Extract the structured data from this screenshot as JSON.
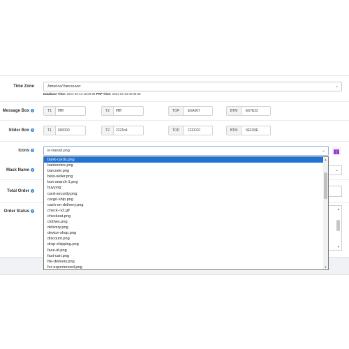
{
  "labels": {
    "time_zone": "Time Zone",
    "message_box": "Message Box",
    "slider_box": "Slider Box",
    "icons": "Icons",
    "mask_name": "Mask Name",
    "total_order": "Total Order",
    "order_status": "Order Status"
  },
  "time_zone": {
    "value": "America/Vancouver",
    "db_time_label": "Database Time:",
    "db_time_value": "2021-03-13 10:09:35",
    "php_time_label": "PHP Time:",
    "php_time_value": "2021-03-13 02:09:35"
  },
  "message_box": {
    "t1_label": "T1",
    "t1_value": "ffffff",
    "t2_label": "T2",
    "t2_value": "ffffff",
    "top_label": "TOP",
    "top_value": "E5A667",
    "btm_label": "BTM",
    "btm_value": "E67E22"
  },
  "slider_box": {
    "t1_label": "T1",
    "t1_value": "000000",
    "t2_label": "T2",
    "t2_value": "2221b4",
    "top_label": "TOP",
    "top_value": "FFFFFF",
    "btm_label": "BTM",
    "btm_value": "9EF09E"
  },
  "icons": {
    "selected": "in-transit.png",
    "options": [
      "bank-cards.png",
      "banknotes.png",
      "barcode.png",
      "best-seller.png",
      "box-search-1.png",
      "buy.png",
      "card-security.png",
      "cargo-ship.png",
      "cash-on-delivery.png",
      "check--v2.gif",
      "checkout.png",
      "clothes.png",
      "delivery.png",
      "device-shop.png",
      "discount.png",
      "drop-shipping.png",
      "face-id.png",
      "fast-cart.png",
      "file-delivery.png",
      "for-experienced.png"
    ],
    "highlighted_index": 0
  },
  "colors": {
    "accent": "#1e73d8",
    "help_icon": "#2f86d4",
    "preview_icon": "#8b3fd0"
  },
  "icon_names": {
    "help": "question-circle-icon",
    "dropdown": "chevron-down-icon",
    "preview": "gift-icon"
  }
}
